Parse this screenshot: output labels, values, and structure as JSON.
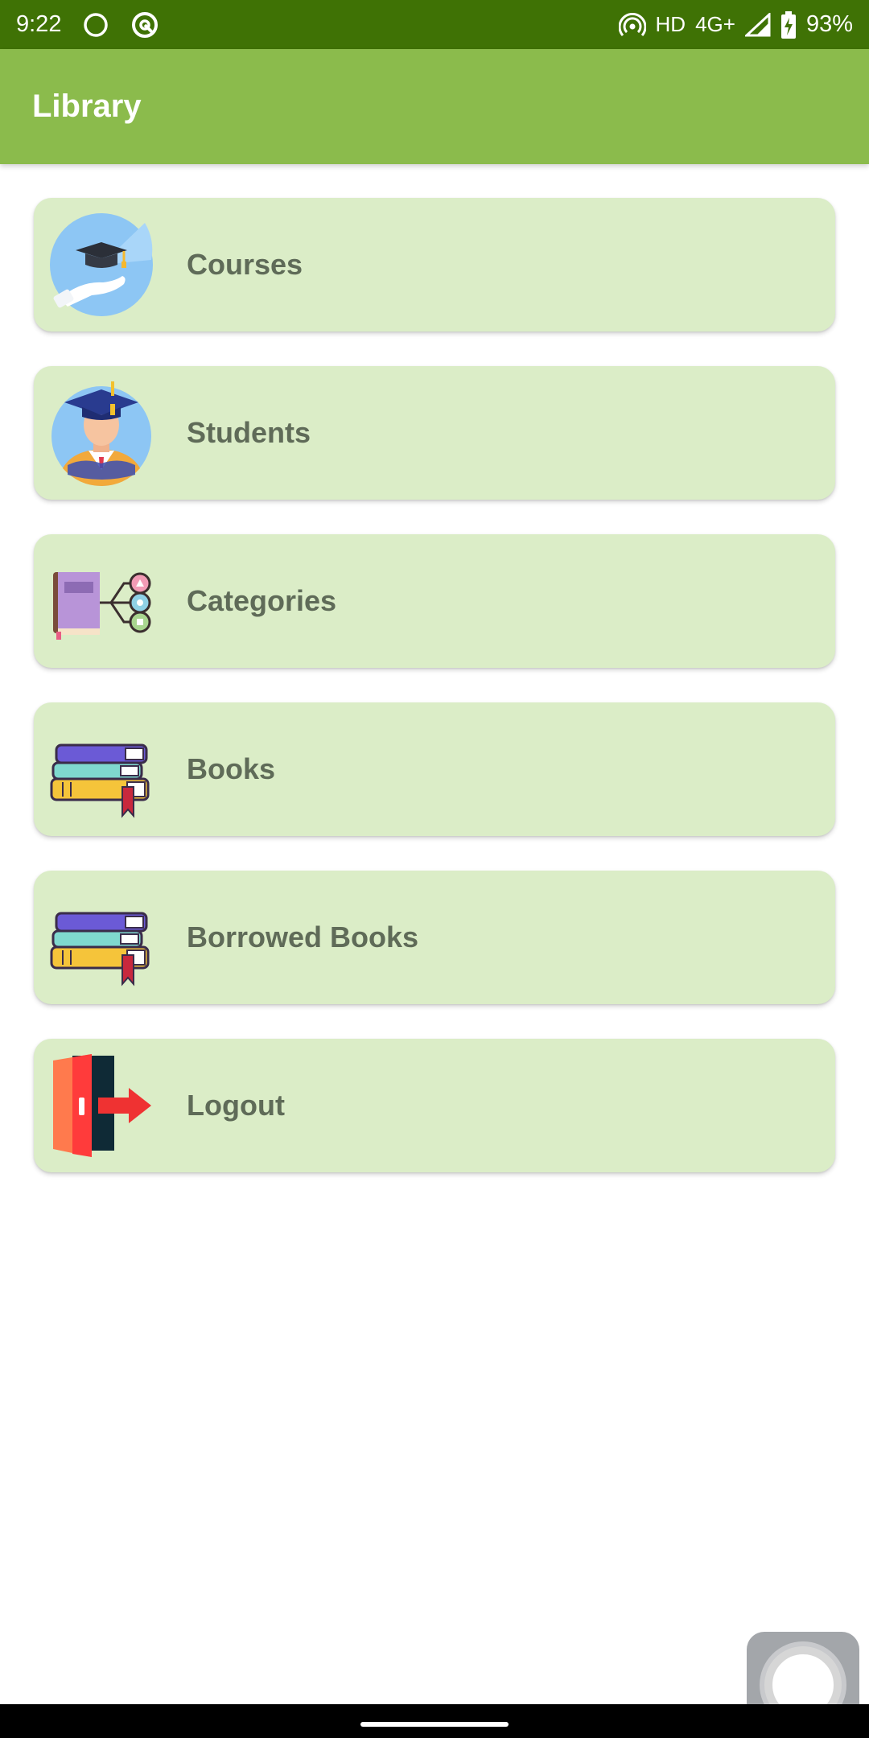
{
  "status_bar": {
    "time": "9:22",
    "left_icons": [
      "circle-icon",
      "at-sign-icon"
    ],
    "network": "HD",
    "signal_type": "4G+",
    "battery": "93%"
  },
  "app_bar": {
    "title": "Library",
    "background": "#8bbb4c"
  },
  "status_bar_color": "#3f7205",
  "card_color": "#dbedc7",
  "menu": {
    "items": [
      {
        "label": "Courses",
        "icon": "graduation-cap-hand-icon"
      },
      {
        "label": "Students",
        "icon": "graduate-student-icon"
      },
      {
        "label": "Categories",
        "icon": "book-categories-icon"
      },
      {
        "label": "Books",
        "icon": "book-stack-icon"
      },
      {
        "label": "Borrowed Books",
        "icon": "book-stack-icon"
      },
      {
        "label": "Logout",
        "icon": "exit-door-icon"
      }
    ]
  }
}
